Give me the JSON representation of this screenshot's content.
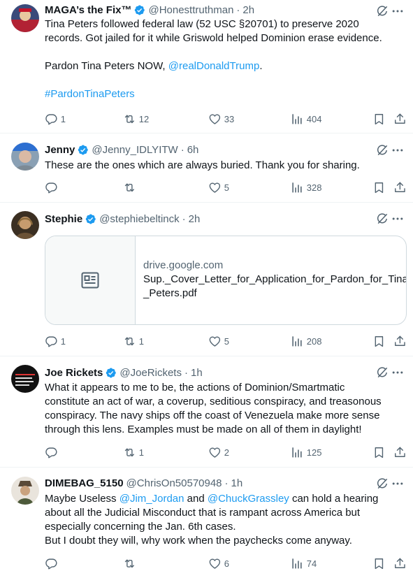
{
  "posts": [
    {
      "name": "MAGA’s the Fix™",
      "handle": "@Honesttruthman",
      "time": "2h",
      "text_line1": "Tina Peters followed federal law (52 USC §20701) to preserve 2020",
      "text_line2": "records. Got jailed for it while Griswold helped Dominion erase evidence.",
      "text_pardon": "Pardon Tina Peters NOW, ",
      "mention": "@realDonaldTrump",
      "text_period": ".",
      "hashtag": "#PardonTinaPeters",
      "replies": "1",
      "reposts": "12",
      "likes": "33",
      "views": "404"
    },
    {
      "name": "Jenny",
      "handle": "@Jenny_IDLYITW",
      "time": "6h",
      "text": "These are the ones which are always buried. Thank you for sharing.",
      "replies": "",
      "reposts": "",
      "likes": "5",
      "views": "328"
    },
    {
      "name": "Stephie",
      "handle": "@stephiebeltinck",
      "time": "2h",
      "card_domain": "drive.google.com",
      "card_title_line1": "Sup._Cover_Letter_for_Application_for_Pardon_for_Tina",
      "card_title_line2": "_Peters.pdf",
      "replies": "1",
      "reposts": "1",
      "likes": "5",
      "views": "208"
    },
    {
      "name": "Joe Rickets",
      "handle": "@JoeRickets",
      "time": "1h",
      "lines": [
        "What it appears to me to be, the actions of Dominion/Smartmatic",
        "constitute an act of war, a coverup, seditious conspiracy, and treasonous",
        "conspiracy. The navy ships off the coast of Venezuela make more sense",
        "through this lens. Examples must be made on all of them in daylight!"
      ],
      "replies": "",
      "reposts": "1",
      "likes": "2",
      "views": "125"
    },
    {
      "name": "DIMEBAG_5150",
      "handle": "@ChrisOn50570948",
      "time": "1h",
      "line1_a": "Maybe Useless ",
      "mention1": "@Jim_Jordan",
      "line1_b": " and ",
      "mention2": "@ChuckGrassley",
      "line1_c": " can hold a hearing",
      "line2": "about all the Judicial Misconduct that is rampant across America but",
      "line3": "especially concerning the Jan. 6th cases.",
      "line4": "But I doubt they will, why work when the paychecks come anyway.",
      "replies": "",
      "reposts": "",
      "likes": "6",
      "views": "74"
    }
  ],
  "separator": "·",
  "colors": {
    "text": "#0f1419",
    "secondary": "#536471",
    "link": "#1d9bf0",
    "verified": "#1d9bf0",
    "border": "#eff3f4"
  }
}
